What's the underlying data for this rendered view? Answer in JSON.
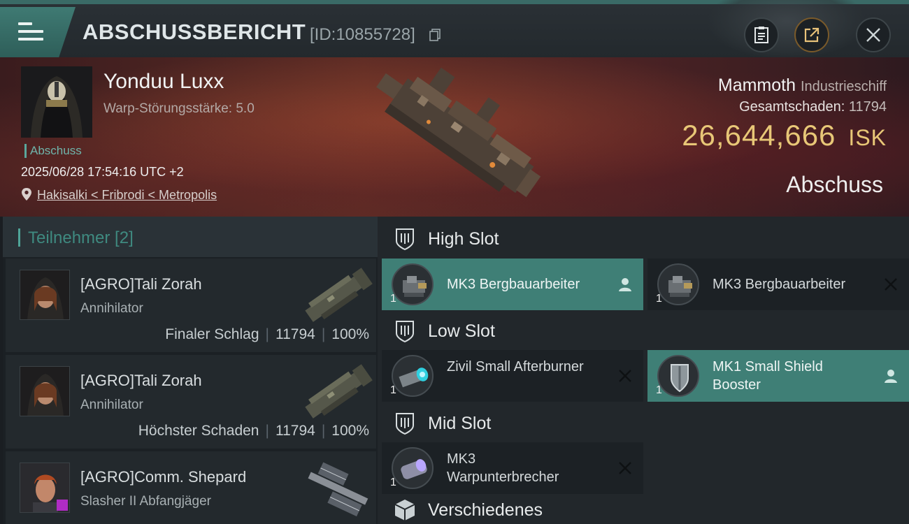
{
  "header": {
    "title": "ABSCHUSSBERICHT",
    "report_id": "[ID:10855728]"
  },
  "victim": {
    "pilot_name": "Yonduu Luxx",
    "warp_strength": "Warp-Störungsstärke: 5.0",
    "kill_tag": "Abschuss",
    "datetime": "2025/06/28 17:54:16 UTC +2",
    "location": "Hakisalki < Fribrodi < Metropolis",
    "ship_name": "Mammoth",
    "ship_class": "Industrieschiff",
    "damage_label": "Gesamtschaden:",
    "damage_value": "11794",
    "isk_value": "26,644,666",
    "isk_unit": "ISK",
    "result_label": "Abschuss"
  },
  "participants": {
    "title": "Teilnehmer [2]",
    "items": [
      {
        "name": "[AGRO]Tali Zorah",
        "ship": "Annihilator",
        "role": "Finaler Schlag",
        "damage": "11794",
        "percent": "100%"
      },
      {
        "name": "[AGRO]Tali Zorah",
        "ship": "Annihilator",
        "role": "Höchster Schaden",
        "damage": "11794",
        "percent": "100%"
      },
      {
        "name": "[AGRO]Comm. Shepard",
        "ship": "Slasher II Abfangjäger"
      }
    ]
  },
  "slots": {
    "high": {
      "label": "High Slot",
      "modules": [
        {
          "name": "MK3 Bergbauarbeiter",
          "qty": "1",
          "state": "active",
          "icon": "mining-laser-icon"
        },
        {
          "name": "MK3 Bergbauarbeiter",
          "qty": "1",
          "state": "destroyed",
          "icon": "mining-laser-icon"
        }
      ]
    },
    "low": {
      "label": "Low Slot",
      "modules": [
        {
          "name": "Zivil Small Afterburner",
          "qty": "1",
          "state": "destroyed",
          "icon": "afterburner-icon"
        },
        {
          "name": "MK1 Small Shield Booster",
          "qty": "1",
          "state": "active",
          "icon": "shield-booster-icon"
        }
      ]
    },
    "mid": {
      "label": "Mid Slot",
      "modules": [
        {
          "name": "MK3 Warpunterbrecher",
          "qty": "1",
          "state": "destroyed",
          "icon": "warp-disruptor-icon"
        }
      ]
    },
    "misc": {
      "label": "Verschiedenes"
    }
  },
  "colors": {
    "accent": "#3f7f76",
    "isk": "#e8c777",
    "banner": "#4a2224"
  }
}
